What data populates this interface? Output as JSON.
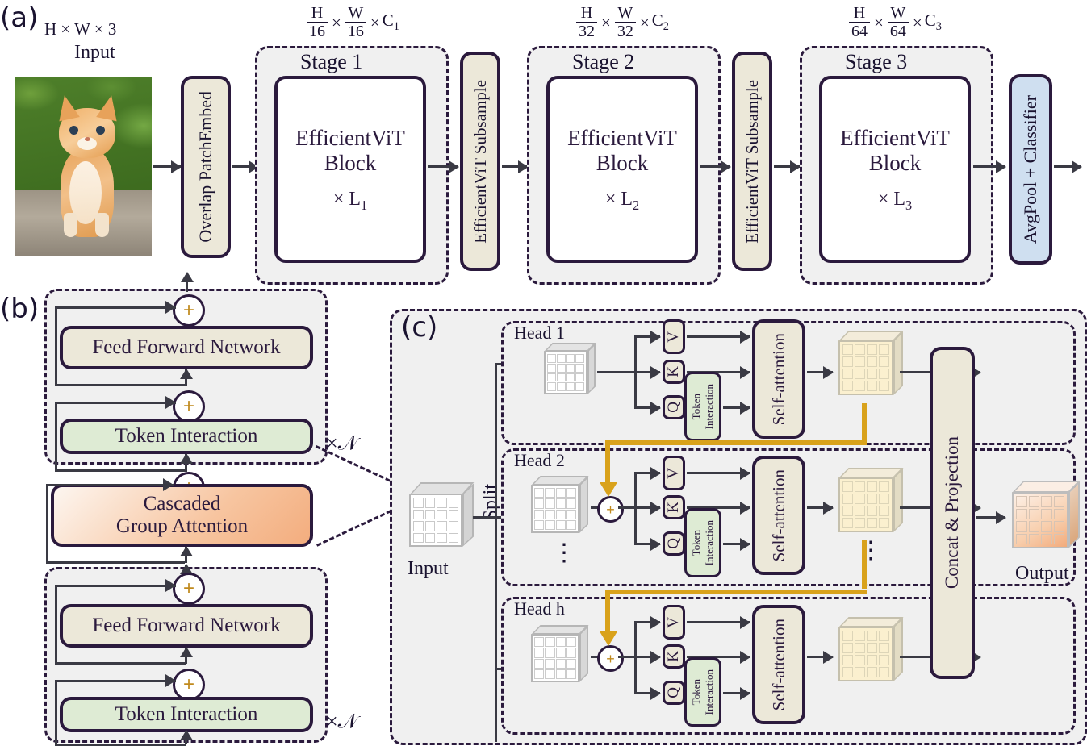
{
  "figure": {
    "panels": [
      {
        "id": "a",
        "label": "(a)"
      },
      {
        "id": "b",
        "label": "(b)"
      },
      {
        "id": "c",
        "label": "(c)"
      }
    ]
  },
  "panel_a": {
    "input_dim": {
      "text": "H × W × 3"
    },
    "input_label": "Input",
    "patch_embed": "Overlap PatchEmbed",
    "stages": [
      {
        "title": "Stage 1",
        "dim_num": "H",
        "dim_den": "16",
        "dim_num2": "W",
        "dim_den2": "16",
        "channel": "C",
        "channel_sub": "1",
        "block": "EfficientViT",
        "block2": "Block",
        "repeat_x": "×",
        "repeat_l": "L",
        "repeat_sub": "1"
      },
      {
        "title": "Stage 2",
        "dim_num": "H",
        "dim_den": "32",
        "dim_num2": "W",
        "dim_den2": "32",
        "channel": "C",
        "channel_sub": "2",
        "block": "EfficientViT",
        "block2": "Block",
        "repeat_x": "×",
        "repeat_l": "L",
        "repeat_sub": "2"
      },
      {
        "title": "Stage 3",
        "dim_num": "H",
        "dim_den": "64",
        "dim_num2": "W",
        "dim_den2": "64",
        "channel": "C",
        "channel_sub": "3",
        "block": "EfficientViT",
        "block2": "Block",
        "repeat_x": "×",
        "repeat_l": "L",
        "repeat_sub": "3"
      }
    ],
    "subsample_1": "EfficientViT Subsample",
    "subsample_2": "EfficientViT Subsample",
    "head": "AvgPool + Classifier"
  },
  "panel_b": {
    "groups": [
      {
        "ffn": "Feed Forward Network",
        "token": "Token Interaction",
        "repeat": "×𝒩"
      },
      {
        "ffn": "Feed Forward Network",
        "token": "Token Interaction",
        "repeat": "×𝒩"
      }
    ],
    "attention_line1": "Cascaded",
    "attention_line2": "Group Attention",
    "plus_symbol": "+"
  },
  "panel_c": {
    "input_label": "Input",
    "split_label": "Split",
    "output_label": "Output",
    "concat_label": "Concat & Projection",
    "plus_symbol": "+",
    "ellipsis": "⋮",
    "heads": [
      {
        "name": "Head 1",
        "v": "V",
        "k": "K",
        "q": "Q",
        "token": "Token",
        "token2": "Interaction",
        "attn": "Self-attention"
      },
      {
        "name": "Head 2",
        "v": "V",
        "k": "K",
        "q": "Q",
        "token": "Token",
        "token2": "Interaction",
        "attn": "Self-attention"
      },
      {
        "name": "Head h",
        "v": "V",
        "k": "K",
        "q": "Q",
        "token": "Token",
        "token2": "Interaction",
        "attn": "Self-attention"
      }
    ]
  },
  "colors": {
    "outline": "#2b1a3d",
    "cream": "#ece8d9",
    "green": "#deebd4",
    "blue": "#cfdff0",
    "orange_start": "#f6b98b",
    "panel_bg": "#f0f0f0",
    "yellow_arrow": "#d9a21b",
    "yellow_cube": "#fbf0cf",
    "arrow": "#3a3a44"
  }
}
